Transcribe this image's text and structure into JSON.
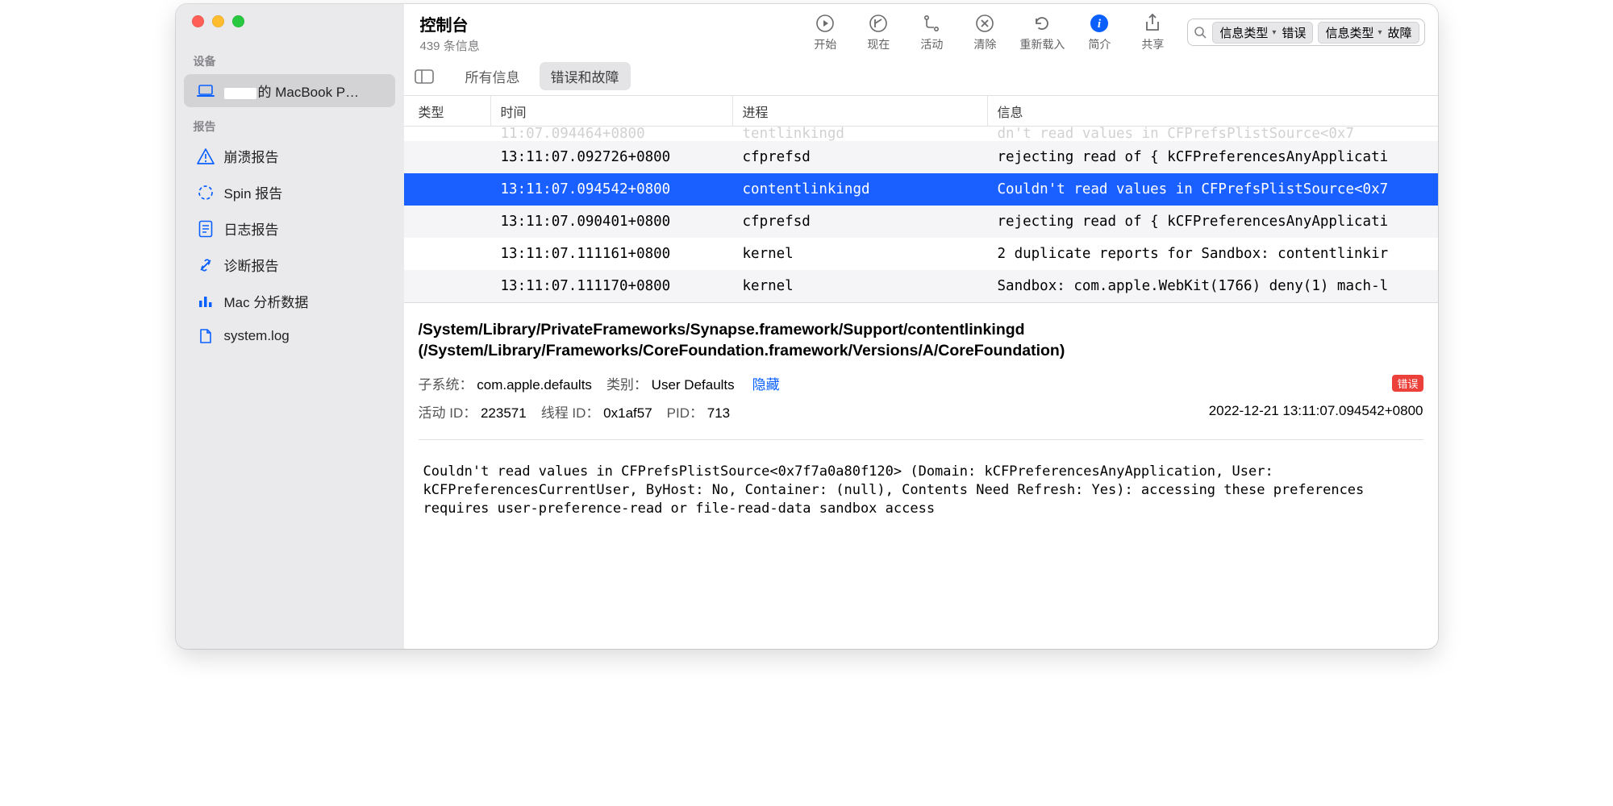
{
  "window": {
    "title": "控制台",
    "subtitle": "439 条信息"
  },
  "sidebar": {
    "sections": [
      {
        "title": "设备",
        "items": [
          {
            "label_prefix_redacted": true,
            "label": "的 MacBook P…",
            "icon": "laptop",
            "selected": true
          }
        ]
      },
      {
        "title": "报告",
        "items": [
          {
            "label": "崩溃报告",
            "icon": "warning"
          },
          {
            "label": "Spin 报告",
            "icon": "spinner"
          },
          {
            "label": "日志报告",
            "icon": "file-lines"
          },
          {
            "label": "诊断报告",
            "icon": "tools"
          },
          {
            "label": "Mac 分析数据",
            "icon": "chart"
          },
          {
            "label": "system.log",
            "icon": "file"
          }
        ]
      }
    ]
  },
  "toolbar": {
    "buttons": [
      {
        "label": "开始",
        "icon": "play"
      },
      {
        "label": "现在",
        "icon": "back-now"
      },
      {
        "label": "活动",
        "icon": "activity"
      },
      {
        "label": "清除",
        "icon": "x-circle"
      },
      {
        "label": "重新载入",
        "icon": "reload"
      },
      {
        "label": "简介",
        "icon": "info",
        "accent": true
      },
      {
        "label": "共享",
        "icon": "share"
      }
    ],
    "search": {
      "tokens": [
        {
          "key": "信息类型",
          "value": "错误"
        },
        {
          "key": "信息类型",
          "value": "故障"
        }
      ]
    }
  },
  "tabs": {
    "items": [
      {
        "label": "所有信息",
        "active": false
      },
      {
        "label": "错误和故障",
        "active": true
      }
    ]
  },
  "table": {
    "headers": {
      "type": "类型",
      "time": "时间",
      "process": "进程",
      "message": "信息"
    },
    "rows": [
      {
        "level": "red",
        "partial": true,
        "time": "11:07.094464+0800",
        "process": "tentlinkingd",
        "message": "dn't read values in CFPrefsPlistSource<0x7"
      },
      {
        "level": "yellow",
        "time": "13:11:07.092726+0800",
        "process": "cfprefsd",
        "message": "rejecting read of { kCFPreferencesAnyApplicati"
      },
      {
        "level": "red",
        "selected": true,
        "time": "13:11:07.094542+0800",
        "process": "contentlinkingd",
        "message": "Couldn't read values in CFPrefsPlistSource<0x7"
      },
      {
        "level": "yellow",
        "time": "13:11:07.090401+0800",
        "process": "cfprefsd",
        "message": "rejecting read of { kCFPreferencesAnyApplicati"
      },
      {
        "level": "yellow",
        "time": "13:11:07.111161+0800",
        "process": "kernel",
        "message": "2 duplicate reports for Sandbox: contentlinkir"
      },
      {
        "level": "yellow",
        "time": "13:11:07.111170+0800",
        "process": "kernel",
        "message": "Sandbox: com.apple.WebKit(1766) deny(1) mach-l"
      }
    ]
  },
  "detail": {
    "header": "/System/Library/PrivateFrameworks/Synapse.framework/Support/contentlinkingd (/System/Library/Frameworks/CoreFoundation.framework/Versions/A/CoreFoundation)",
    "subsystem_label": "子系统：",
    "subsystem": "com.apple.defaults",
    "category_label": "类别：",
    "category": "User Defaults",
    "hide_link": "隐藏",
    "badge": "错误",
    "activity_label": "活动 ID：",
    "activity": "223571",
    "thread_label": "线程 ID：",
    "thread": "0x1af57",
    "pid_label": "PID：",
    "pid": "713",
    "timestamp": "2022-12-21 13:11:07.094542+0800",
    "body": "Couldn't read values in CFPrefsPlistSource<0x7f7a0a80f120> (Domain: kCFPreferencesAnyApplication, User: kCFPreferencesCurrentUser, ByHost: No, Container: (null), Contents Need Refresh: Yes): accessing these preferences requires user-preference-read or file-read-data sandbox access"
  }
}
